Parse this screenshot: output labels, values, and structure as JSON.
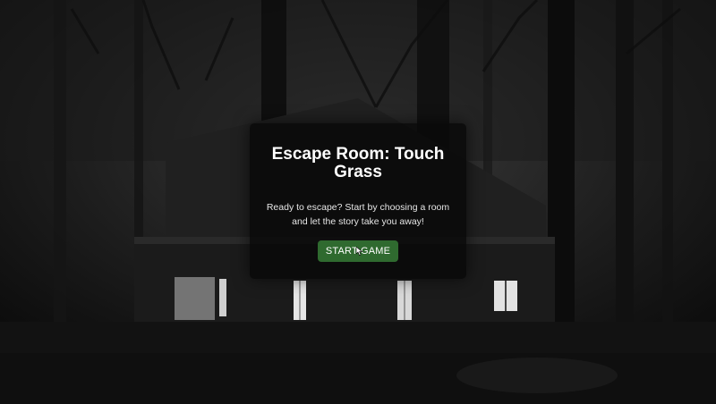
{
  "modal": {
    "title": "Escape Room: Touch Grass",
    "description": "Ready to escape? Start by choosing a room and let the story take you away!",
    "start_button_label": "START GAME"
  },
  "colors": {
    "button_background": "#2f6a2f",
    "modal_background": "#080808",
    "text": "#ffffff"
  },
  "background": {
    "scene": "dark forest with house at night",
    "icon": "forest-house-background"
  }
}
